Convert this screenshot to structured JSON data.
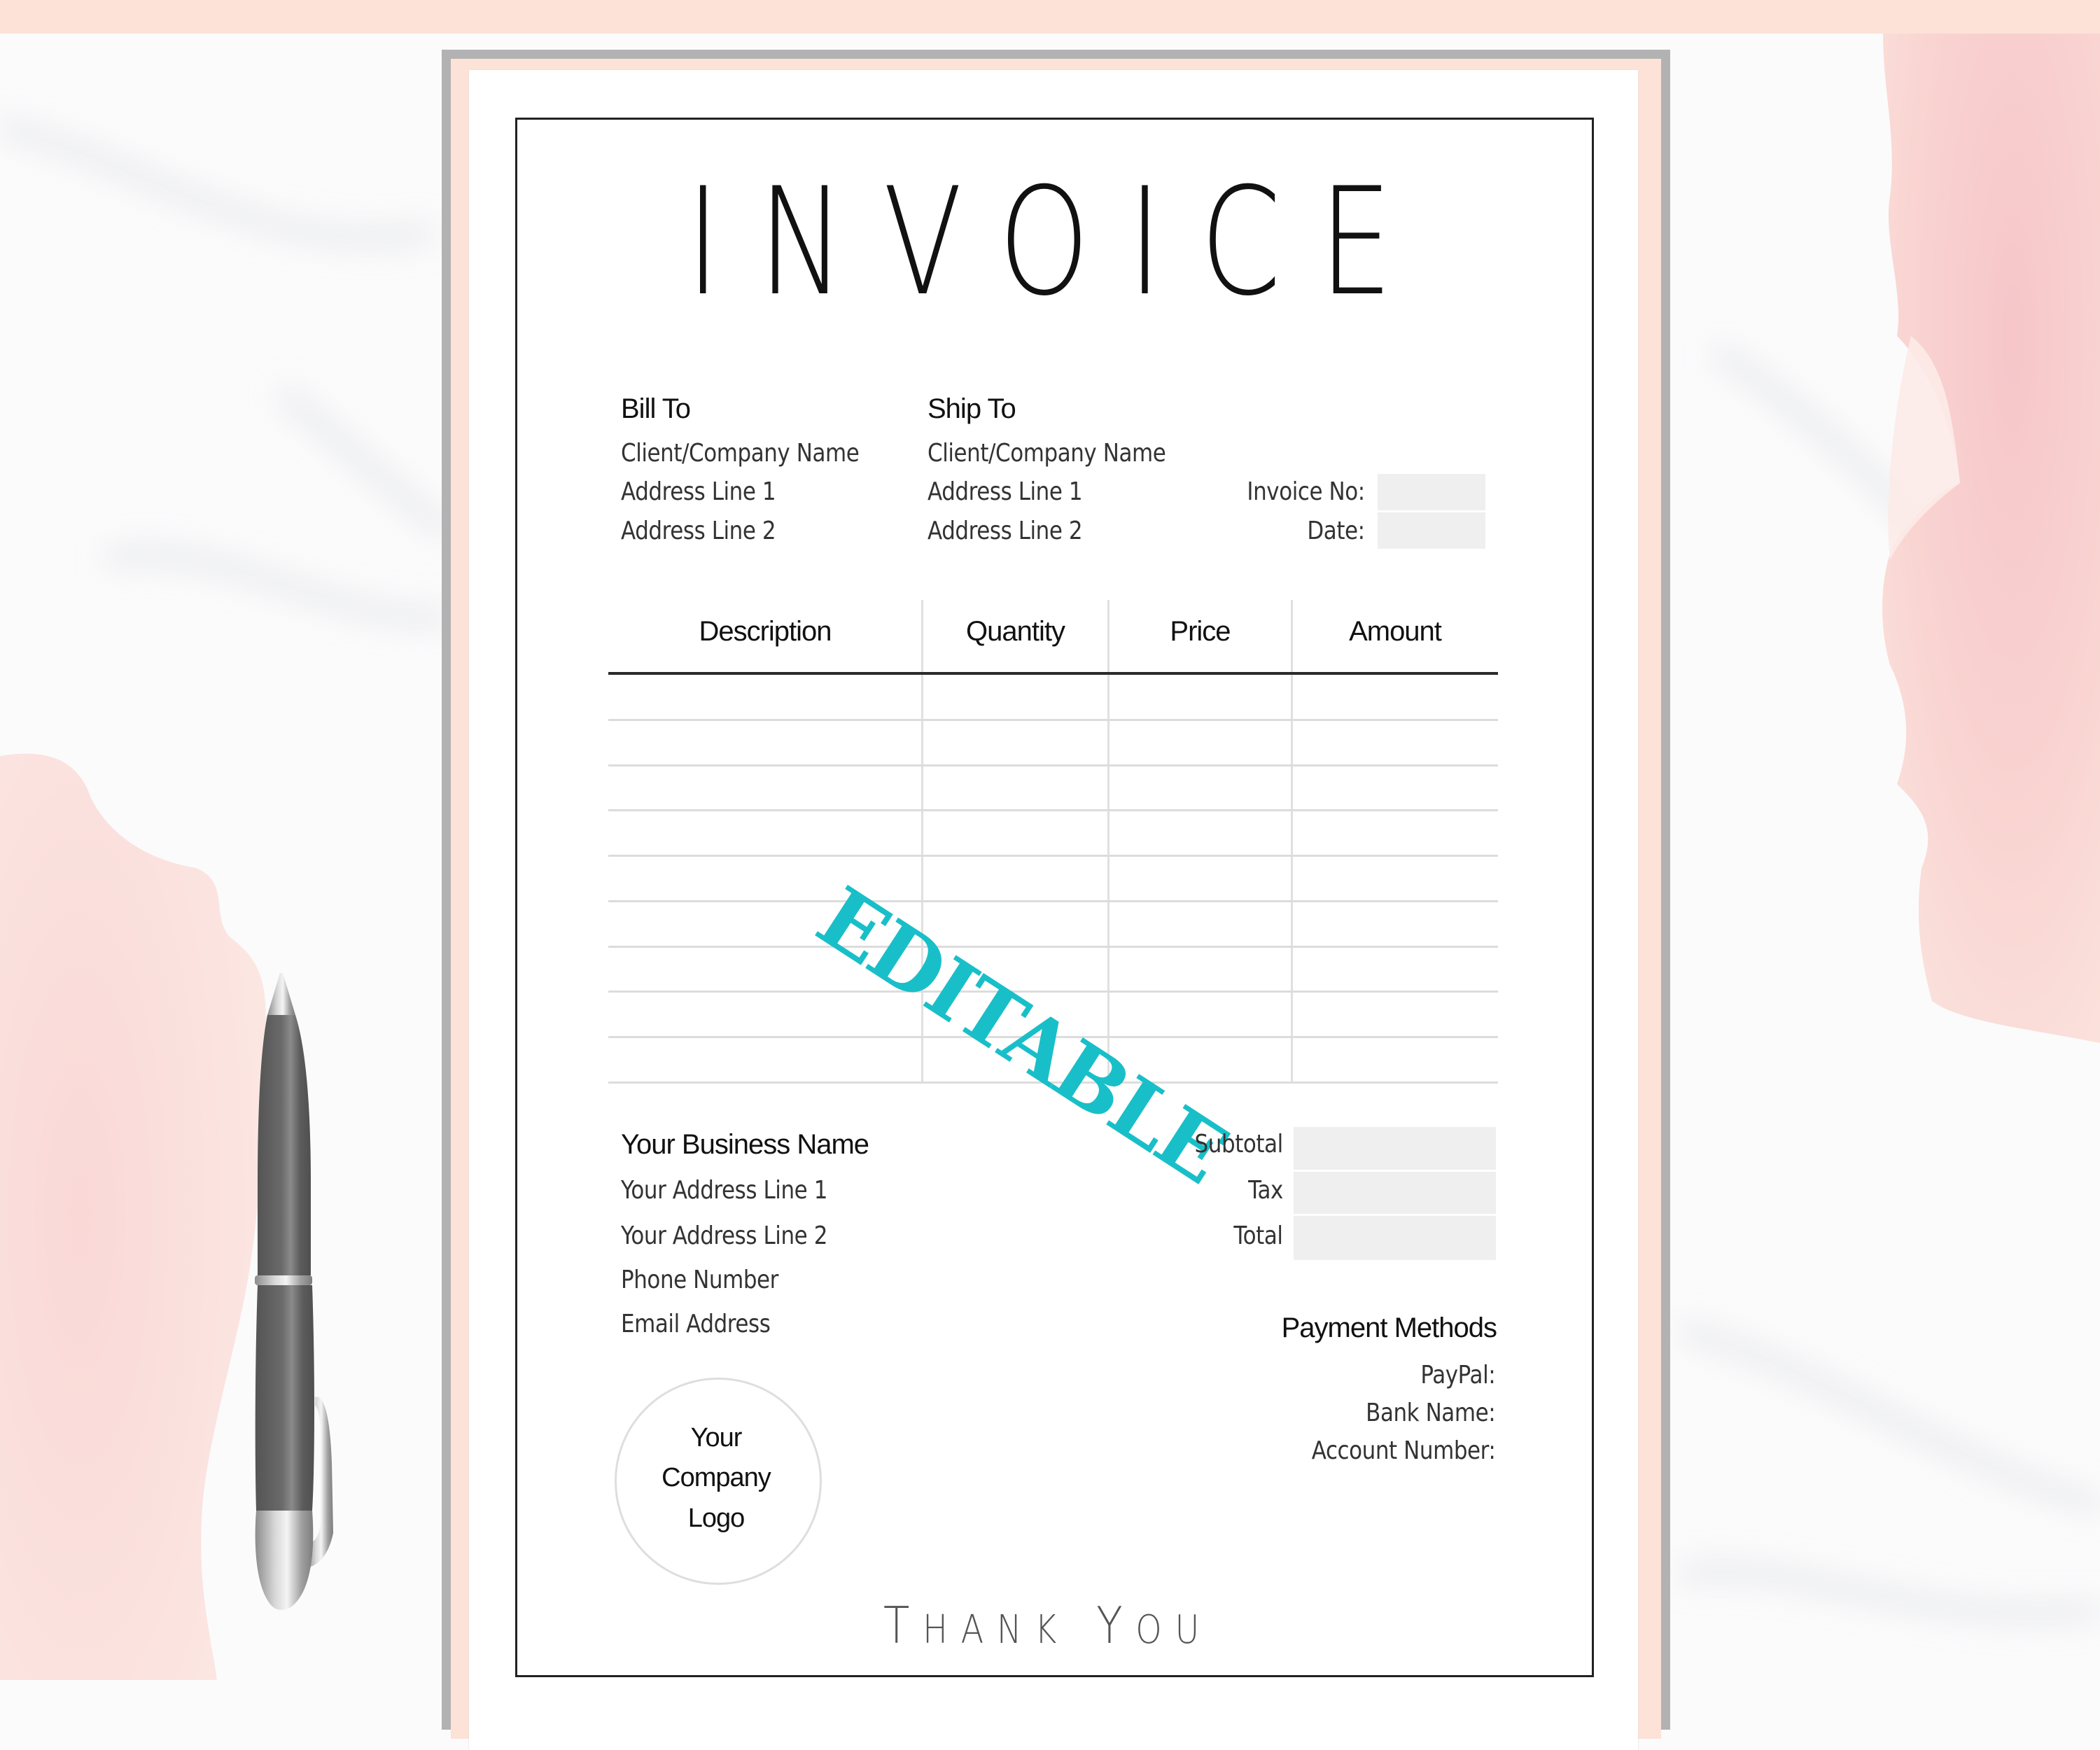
{
  "document": {
    "title": "INVOICE",
    "watermark": "EDITABLE",
    "watermark_color": "#19bfc8",
    "accent_color": "#fde2d7"
  },
  "bill_to": {
    "heading": "Bill To",
    "lines": [
      "Client/Company Name",
      "Address Line 1",
      "Address Line 2"
    ]
  },
  "ship_to": {
    "heading": "Ship To",
    "lines": [
      "Client/Company Name",
      "Address Line 1",
      "Address Line 2"
    ]
  },
  "invoice_meta": {
    "invoice_no_label": "Invoice No:",
    "invoice_no_value": "",
    "date_label": "Date:",
    "date_value": ""
  },
  "table": {
    "columns": [
      "Description",
      "Quantity",
      "Price",
      "Amount"
    ],
    "rows": [
      [
        "",
        "",
        "",
        ""
      ],
      [
        "",
        "",
        "",
        ""
      ],
      [
        "",
        "",
        "",
        ""
      ],
      [
        "",
        "",
        "",
        ""
      ],
      [
        "",
        "",
        "",
        ""
      ],
      [
        "",
        "",
        "",
        ""
      ],
      [
        "",
        "",
        "",
        ""
      ],
      [
        "",
        "",
        "",
        ""
      ],
      [
        "",
        "",
        "",
        ""
      ]
    ]
  },
  "business": {
    "name": "Your Business Name",
    "lines": [
      "Your Address Line 1",
      "Your Address Line 2",
      "Phone Number",
      "Email Address"
    ]
  },
  "totals": [
    {
      "label": "Subtotal",
      "value": ""
    },
    {
      "label": "Tax",
      "value": ""
    },
    {
      "label": "Total",
      "value": ""
    }
  ],
  "payment": {
    "heading": "Payment Methods",
    "lines": [
      "PayPal:",
      "Bank Name:",
      "Account Number:"
    ]
  },
  "logo": {
    "lines": [
      "Your",
      "Company",
      "Logo"
    ]
  },
  "footer": {
    "thank_you_first": "T",
    "thank_you_rest1": "HANK",
    "thank_you_y": "Y",
    "thank_you_rest2": "OU",
    "thank_you": "THANK YOU"
  }
}
